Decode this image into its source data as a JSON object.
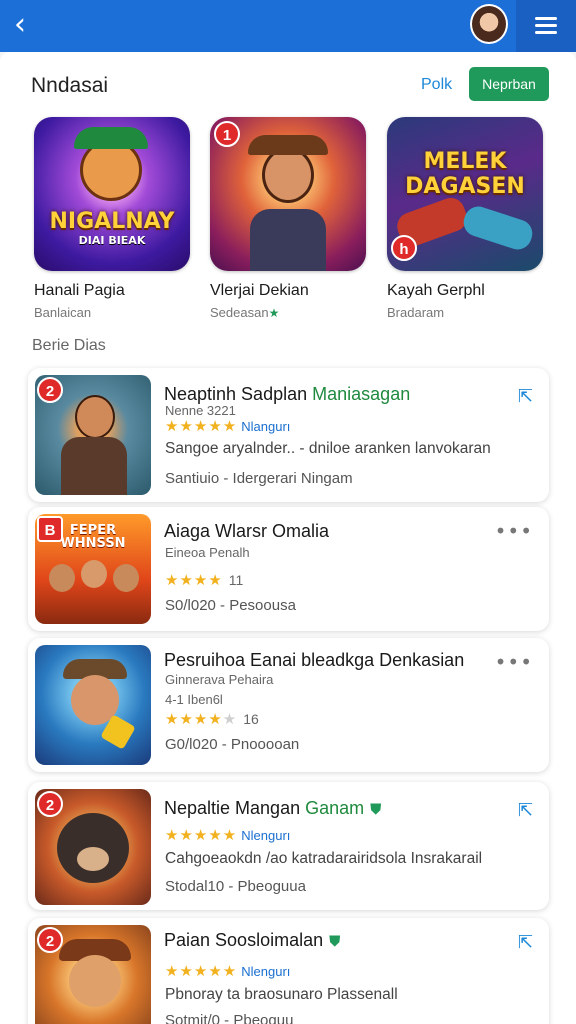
{
  "header": {
    "back_icon": "back-arrow-icon",
    "menu_icon": "hamburger-menu-icon",
    "colors": {
      "bar": "#1d6fd8",
      "accent_green": "#1f9a5a"
    }
  },
  "top_section": {
    "title": "Nndasai",
    "more_link": "Polk",
    "button_label": "Neprban"
  },
  "featured": [
    {
      "thumb_text": "NIGALNAY",
      "thumb_sub": "DIAI BIEAK",
      "name": "Hanali Pagia",
      "sub": "Banlaican"
    },
    {
      "badge": "1",
      "name": "Vlerjai Dekian",
      "sub": "Sedeasan",
      "verified": "★"
    },
    {
      "thumb_text": "MELEK DAGASEN",
      "badge_icon": "h",
      "name": "Kayah Gerphl",
      "sub": "Bradaram"
    }
  ],
  "list_heading": "Berie Dias",
  "list": [
    {
      "badge": "2",
      "title": "Neaptinh Sadplan",
      "title_accent": "Maniasagan",
      "meta": "Nenne 3221",
      "stars": "★★★★★",
      "stars_off": "",
      "tag": "Nlangurı",
      "desc": "Sangoe aryalnder.. - dniloe aranken lanvokaran",
      "foot": "Santiuio - Idergerari Ningam",
      "action_icon": "share-icon"
    },
    {
      "thumb_text": "FEPER WHNSSN",
      "title": "Aiaga Wlarsr Omalia",
      "meta": "Eineoa Penalh",
      "stars": "★★★★",
      "stars_off": "",
      "count": "11",
      "foot": "S0/l020 - Pesoousa",
      "action_icon": "more-dots-icon"
    },
    {
      "title": "Pesruihoa Eanai bleadkga Denkasian",
      "meta": "Ginnerava Pehaira",
      "meta2": "4-1 Iben6l",
      "stars": "★★★★",
      "stars_off": "★",
      "count": "16",
      "foot": "G0/l020 - Pnooooan",
      "action_icon": "more-dots-icon"
    },
    {
      "badge": "2",
      "title": "Nepaltie Mangan",
      "title_accent": "Ganam",
      "stars": "★★★★★",
      "stars_off": "",
      "tag": "Nlengurı",
      "desc": "Cahgoeaokdn /ao katradarairidsola Insrakarail",
      "foot": "Stodal10 - Pbeoguua",
      "action_icon": "share-icon"
    },
    {
      "badge": "2",
      "title": "Paian Soosloimalan",
      "stars": "★★★★★",
      "stars_off": "",
      "tag": "Nlengurı",
      "desc": "Pbnoray ta braosunaro Plassenall",
      "foot": "Sotmit/0 - Pbeoguu",
      "action_icon": "share-icon"
    }
  ]
}
